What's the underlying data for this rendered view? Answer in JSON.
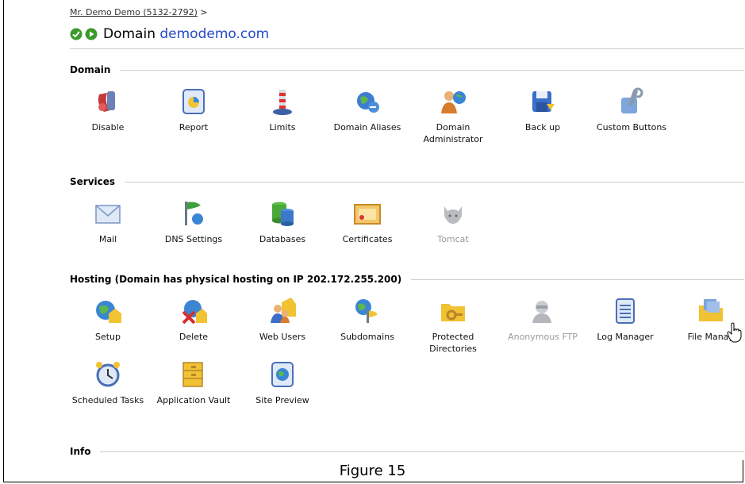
{
  "breadcrumb": "Mr. Demo Demo (5132-2792)",
  "breadcrumb_sep": ">",
  "title_prefix": "Domain",
  "domain_name": "demodemo.com",
  "sections": {
    "domain": {
      "heading": "Domain",
      "items": [
        "Disable",
        "Report",
        "Limits",
        "Domain Aliases",
        "Domain Administrator",
        "Back up",
        "Custom Buttons"
      ]
    },
    "services": {
      "heading": "Services",
      "items": [
        "Mail",
        "DNS Settings",
        "Databases",
        "Certificates",
        "Tomcat"
      ]
    },
    "hosting": {
      "heading": "Hosting (Domain has physical hosting on IP 202.172.255.200)",
      "items": [
        "Setup",
        "Delete",
        "Web Users",
        "Subdomains",
        "Protected Directories",
        "Anonymous FTP",
        "Log Manager",
        "File Manag",
        "Scheduled Tasks",
        "Application Vault",
        "Site Preview"
      ]
    },
    "info": {
      "heading": "Info"
    }
  },
  "caption": "Figure 15",
  "colors": {
    "link": "#2249c7",
    "disabled": "#999999",
    "rule": "#cccccc"
  }
}
